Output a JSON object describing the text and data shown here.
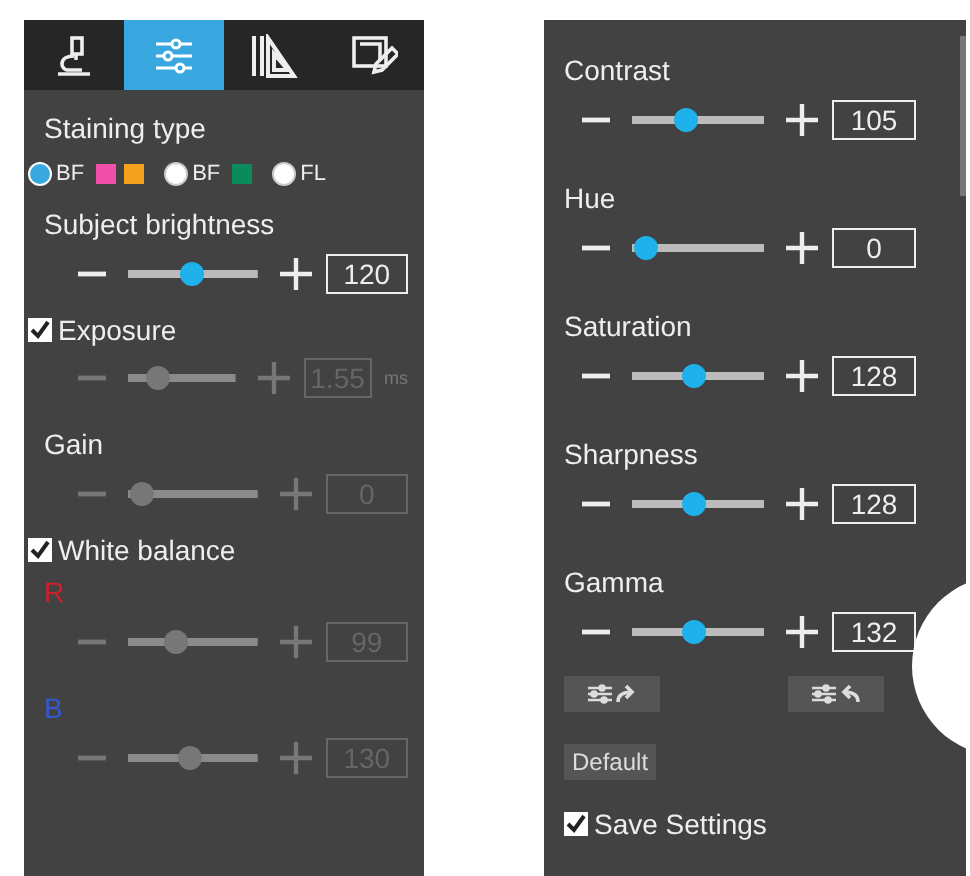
{
  "left_panel": {
    "tabs": [
      {
        "kind": "microscope",
        "selected": false
      },
      {
        "kind": "sliders",
        "selected": true
      },
      {
        "kind": "ruler",
        "selected": false
      },
      {
        "kind": "edit",
        "selected": false
      }
    ],
    "staining_type": {
      "label": "Staining type",
      "options": [
        {
          "label": "BF",
          "selected": true,
          "swatches": [
            {
              "color": "#f050a8"
            },
            {
              "color": "#f5a21e"
            }
          ]
        },
        {
          "label": "BF",
          "selected": false,
          "swatches": [
            {
              "color": "#0b8a5c"
            }
          ]
        },
        {
          "label": "FL",
          "selected": false
        }
      ]
    },
    "controls": [
      {
        "kind": "heading",
        "label": "Subject brightness"
      },
      {
        "kind": "slider",
        "level": 0.5,
        "value": "120",
        "disabled": false
      },
      {
        "kind": "checkbox",
        "label": "Exposure",
        "checked": true
      },
      {
        "kind": "slider",
        "level": 0.22,
        "value": "1.55",
        "unit": "ms",
        "disabled": true
      },
      {
        "kind": "heading",
        "label": "Gain"
      },
      {
        "kind": "slider",
        "level": 0.02,
        "value": "0",
        "disabled": true
      },
      {
        "kind": "checkbox",
        "label": "White balance",
        "checked": true
      },
      {
        "kind": "heading",
        "label": "R",
        "color": "#d0202a"
      },
      {
        "kind": "slider",
        "level": 0.35,
        "value": "99",
        "disabled": true
      },
      {
        "kind": "heading",
        "label": "B",
        "color": "#3458d0"
      },
      {
        "kind": "slider",
        "level": 0.48,
        "value": "130",
        "disabled": true
      }
    ]
  },
  "right_panel": {
    "controls": [
      {
        "kind": "heading",
        "label": "Contrast"
      },
      {
        "kind": "slider",
        "level": 0.38,
        "value": "105",
        "disabled": false
      },
      {
        "kind": "heading",
        "label": "Hue"
      },
      {
        "kind": "slider",
        "level": 0.02,
        "value": "0",
        "disabled": false
      },
      {
        "kind": "heading",
        "label": "Saturation"
      },
      {
        "kind": "slider",
        "level": 0.47,
        "value": "128",
        "disabled": false
      },
      {
        "kind": "heading",
        "label": "Sharpness"
      },
      {
        "kind": "slider",
        "level": 0.47,
        "value": "128",
        "disabled": false
      },
      {
        "kind": "heading",
        "label": "Gamma"
      },
      {
        "kind": "slider",
        "level": 0.47,
        "value": "132",
        "disabled": false
      }
    ],
    "icon_buttons": [
      {
        "kind": "export"
      },
      {
        "kind": "import"
      }
    ],
    "default_button": "Default",
    "save_settings": {
      "label": "Save Settings",
      "checked": true
    }
  }
}
